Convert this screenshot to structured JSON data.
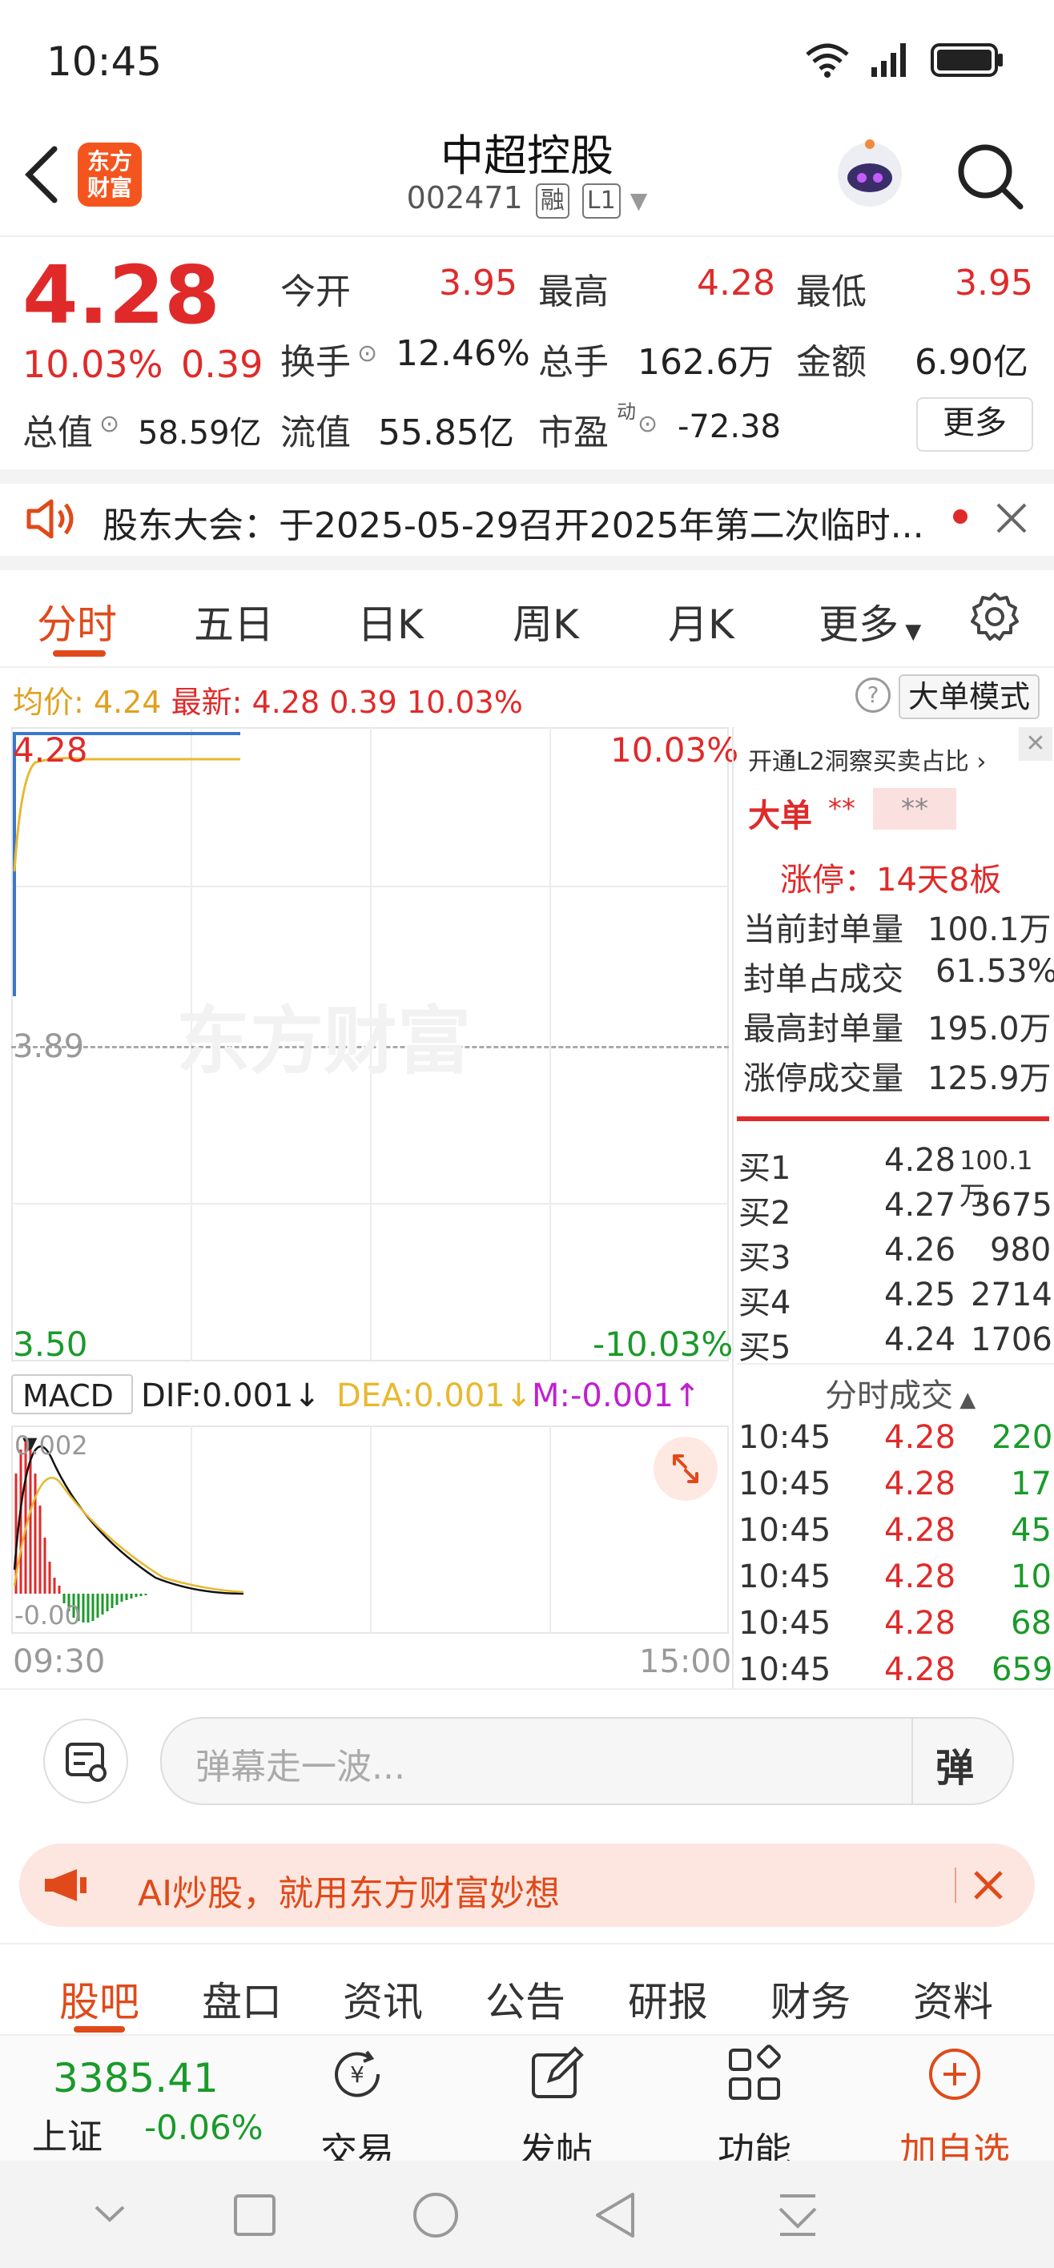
{
  "status": {
    "time": "10:45"
  },
  "header": {
    "title": "中超控股",
    "code": "002471",
    "tag_rong": "融",
    "tag_l1": "L1",
    "logo_text": "东方财富"
  },
  "quote": {
    "price": "4.28",
    "change_pct": "10.03%",
    "change": "0.39",
    "today_open_label": "今开",
    "today_open": "3.95",
    "high_label": "最高",
    "high": "4.28",
    "low_label": "最低",
    "low": "3.95",
    "turnover_label": "换手",
    "turnover": "12.46%",
    "volume_label": "总手",
    "volume": "162.6万",
    "amount_label": "金额",
    "amount": "6.90亿",
    "mktcap_label": "总值",
    "mktcap": "58.59亿",
    "float_label": "流值",
    "float": "55.85亿",
    "pe_label": "市盈",
    "pe_sup": "动",
    "pe": "-72.38",
    "more": "更多"
  },
  "notice": {
    "text": "股东大会：于2025-05-29召开2025年第二次临时..."
  },
  "tabs": [
    "分时",
    "五日",
    "日K",
    "周K",
    "月K",
    "更多"
  ],
  "info_bar": {
    "avg_label": "均价:",
    "avg": "4.24",
    "latest_label": "最新:",
    "latest": "4.28",
    "latest_change": "0.39",
    "latest_pct": "10.03%",
    "mode": "大单模式"
  },
  "chart": {
    "price_top": "4.28",
    "pct_top": "10.03%",
    "price_mid": "3.89",
    "price_bottom": "3.50",
    "pct_bottom": "-10.03%",
    "watermark": "东方财富",
    "time_start": "09:30",
    "time_end": "15:00"
  },
  "macd": {
    "label": "MACD",
    "dif": "DIF:0.001",
    "dea": "DEA:0.001",
    "m": "M:-0.001",
    "top": "0.002",
    "bottom": "-0.00"
  },
  "side": {
    "l2_link": "开通L2洞察买卖占比",
    "big_label": "大单",
    "big_a": "**",
    "big_b": "**",
    "limit_up": "涨停：14天8板",
    "stats": [
      {
        "label": "当前封单量",
        "value": "100.1万"
      },
      {
        "label": "封单占成交",
        "value": "61.53%"
      },
      {
        "label": "最高封单量",
        "value": "195.0万"
      },
      {
        "label": "涨停成交量",
        "value": "125.9万"
      }
    ],
    "bids": [
      {
        "label": "买1",
        "price": "4.28",
        "vol": "100.1万"
      },
      {
        "label": "买2",
        "price": "4.27",
        "vol": "3675"
      },
      {
        "label": "买3",
        "price": "4.26",
        "vol": "980"
      },
      {
        "label": "买4",
        "price": "4.25",
        "vol": "2714"
      },
      {
        "label": "买5",
        "price": "4.24",
        "vol": "1706"
      }
    ],
    "ticks_title": "分时成交",
    "ticks": [
      {
        "time": "10:45",
        "price": "4.28",
        "vol": "220"
      },
      {
        "time": "10:45",
        "price": "4.28",
        "vol": "17"
      },
      {
        "time": "10:45",
        "price": "4.28",
        "vol": "45"
      },
      {
        "time": "10:45",
        "price": "4.28",
        "vol": "10"
      },
      {
        "time": "10:45",
        "price": "4.28",
        "vol": "68"
      },
      {
        "time": "10:45",
        "price": "4.28",
        "vol": "659"
      }
    ]
  },
  "comment": {
    "placeholder": "弹幕走一波...",
    "danmu": "弹"
  },
  "ai_banner": {
    "text": "AI炒股，就用东方财富妙想"
  },
  "bottom_tabs": [
    "股吧",
    "盘口",
    "资讯",
    "公告",
    "研报",
    "财务",
    "资料"
  ],
  "nav": {
    "index_value": "3385.41",
    "index_name": "上证",
    "index_change": "-0.06%",
    "trade": "交易",
    "post": "发帖",
    "func": "功能",
    "add": "加自选"
  },
  "colors": {
    "up": "#e02a2a",
    "down": "#1a9a2a",
    "accent": "#e04a1a"
  }
}
